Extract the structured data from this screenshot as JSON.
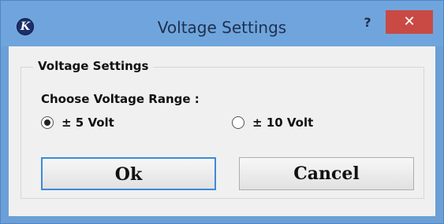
{
  "window": {
    "title": "Voltage Settings",
    "app_icon_letter": "K",
    "help_glyph": "?",
    "close_glyph": "✕"
  },
  "group": {
    "title": "Voltage Settings",
    "prompt": "Choose Voltage Range :"
  },
  "options": [
    {
      "label": "± 5 Volt",
      "selected": true
    },
    {
      "label": "± 10 Volt",
      "selected": false
    }
  ],
  "buttons": {
    "ok_label": "Ok",
    "cancel_label": "Cancel"
  },
  "colors": {
    "titlebar": "#6fa5dc",
    "close_button": "#c94a44",
    "default_button_border": "#3c8ad8"
  }
}
